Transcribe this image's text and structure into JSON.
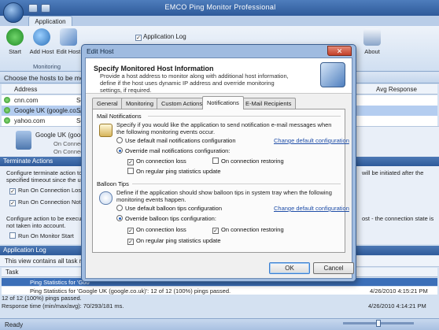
{
  "app": {
    "title": "EMCO Ping Monitor Professional",
    "ribbon_tab": "Application",
    "buttons": {
      "start": "Start",
      "add_host": "Add Host",
      "edit_host": "Edit Host",
      "about": "About"
    },
    "application_log_check": "Application Log",
    "group_monitoring": "Monitoring"
  },
  "hosts": {
    "header": "Choose the hosts to be monitored",
    "columns": {
      "address": "Address",
      "avg_response": "Avg Response"
    },
    "rows": [
      {
        "name": "cnn.com",
        "status": "Se"
      },
      {
        "name": "Google UK (google.co...",
        "status": "Se"
      },
      {
        "name": "yahoo.com",
        "status": "Se"
      }
    ],
    "card": {
      "name": "Google UK (google.co...",
      "line1": "On Connection",
      "line2": "On Connection"
    }
  },
  "terminate": {
    "title": "Terminate Actions",
    "line1": "Configure terminate action to b",
    "line1_right": "will be initiated after the",
    "line2": "specified timeout since the unm",
    "check1": "Run On Connection Lost",
    "check2": "Run On Connection Not Re",
    "line3": "Configure action to be executed",
    "line3_right": "ost - the connection state is",
    "line4": "not taken into account.",
    "check3": "Run On Monitor Start"
  },
  "log": {
    "title": "Application Log",
    "info": "This view contains all task re",
    "col_task": "Task",
    "rows": [
      {
        "text": "Ping Statistics for 'Goo",
        "time": "",
        "selected": true
      },
      {
        "text": "Ping Statistics for 'Google UK (google.co.uk)'",
        "time": "4/26/2010 4:15:21 PM",
        "selected": false
      }
    ],
    "row2_detail": "Ping Statistics for 'Google UK (google.co.uk)': 12 of 12 (100%) pings passed.",
    "detail1": "12 of 12 (100%) pings passed.",
    "detail2": "Response time (min/max/avg): 70/293/181 ms.",
    "time3": "4/26/2010 4:14:21 PM"
  },
  "status": {
    "left": "Ready"
  },
  "dialog": {
    "title": "Edit Host",
    "heading": "Specify Monitored Host Information",
    "subtitle": "Provide a host address to monitor along with additional host information, define if the host uses dynamic IP address and override monitoring settings, if required.",
    "tabs": [
      "General",
      "Monitoring",
      "Custom Actions",
      "Notifications",
      "E-Mail Recipients"
    ],
    "active_tab": "Notifications",
    "mail": {
      "title": "Mail Notifications",
      "desc": "Specify if you would like the application to send notification e-mail messages when the following monitoring events occur.",
      "use_default": "Use default mail notifications configuration",
      "change_link": "Change default configuration",
      "override": "Override mail notifications configuration:",
      "on_loss": "On connection loss",
      "on_restoring": "On connection restoring",
      "on_stats": "On regular ping statistics update"
    },
    "balloon": {
      "title": "Balloon Tips",
      "desc": "Define if the application should show balloon tips in system tray when the following monitoring events happen.",
      "use_default": "Use default balloon tips configuration",
      "change_link": "Change default configuration",
      "override": "Override balloon tips configuration:",
      "on_loss": "On connection loss",
      "on_restoring": "On connection restoring",
      "on_stats": "On regular ping statistics update"
    },
    "ok": "OK",
    "cancel": "Cancel",
    "close_glyph": "✕"
  }
}
